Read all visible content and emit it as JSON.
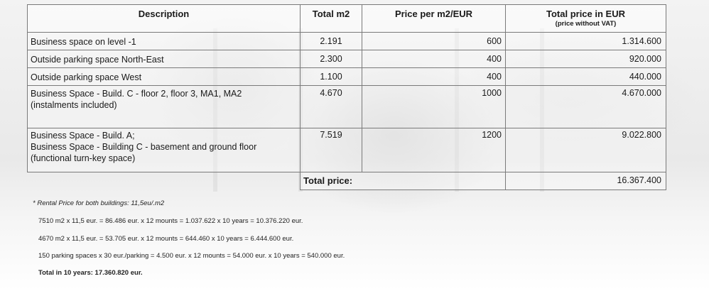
{
  "table": {
    "headers": {
      "description": "Description",
      "total_m2": "Total m2",
      "price_per_m2": "Price per m2/EUR",
      "total_price": "Total price in EUR",
      "total_price_sub": "(price without VAT)"
    },
    "rows": [
      {
        "description": [
          "Business space on level -1"
        ],
        "m2": "2.191",
        "price_per_m2": "600",
        "total": "1.314.600"
      },
      {
        "description": [
          "Outside parking space North-East"
        ],
        "m2": "2.300",
        "price_per_m2": "400",
        "total": "920.000"
      },
      {
        "description": [
          "Outside parking space West"
        ],
        "m2": "1.100",
        "price_per_m2": "400",
        "total": "440.000"
      },
      {
        "description": [
          "Business Space - Build. C - floor 2, floor 3, MA1, MA2",
          "(instalments included)"
        ],
        "m2": "4.670",
        "price_per_m2": "1000",
        "total": "4.670.000"
      },
      {
        "description": [
          "Business Space - Build. A;",
          "Business Space - Building C - basement and ground floor",
          "(functional turn-key space)"
        ],
        "m2": "7.519",
        "price_per_m2": "1200",
        "total": "9.022.800"
      }
    ],
    "total_label": "Total price:",
    "total_value": "16.367.400"
  },
  "notes": {
    "rental": "* Rental Price for both buildings: 11,5eu/.m2",
    "calc1": "7510 m2 x 11,5 eur. = 86.486 eur. x 12 mounts = 1.037.622 x 10 years = 10.376.220 eur.",
    "calc2": "4670 m2 x 11,5 eur. = 53.705 eur. x 12 mounts = 644.460 x 10 years = 6.444.600 eur.",
    "calc3": "150 parking spaces x 30 eur./parking = 4.500 eur. x 12 mounts = 54.000 eur. x 10 years = 540.000 eur.",
    "total": "Total in 10 years: 17.360.820 eur."
  }
}
